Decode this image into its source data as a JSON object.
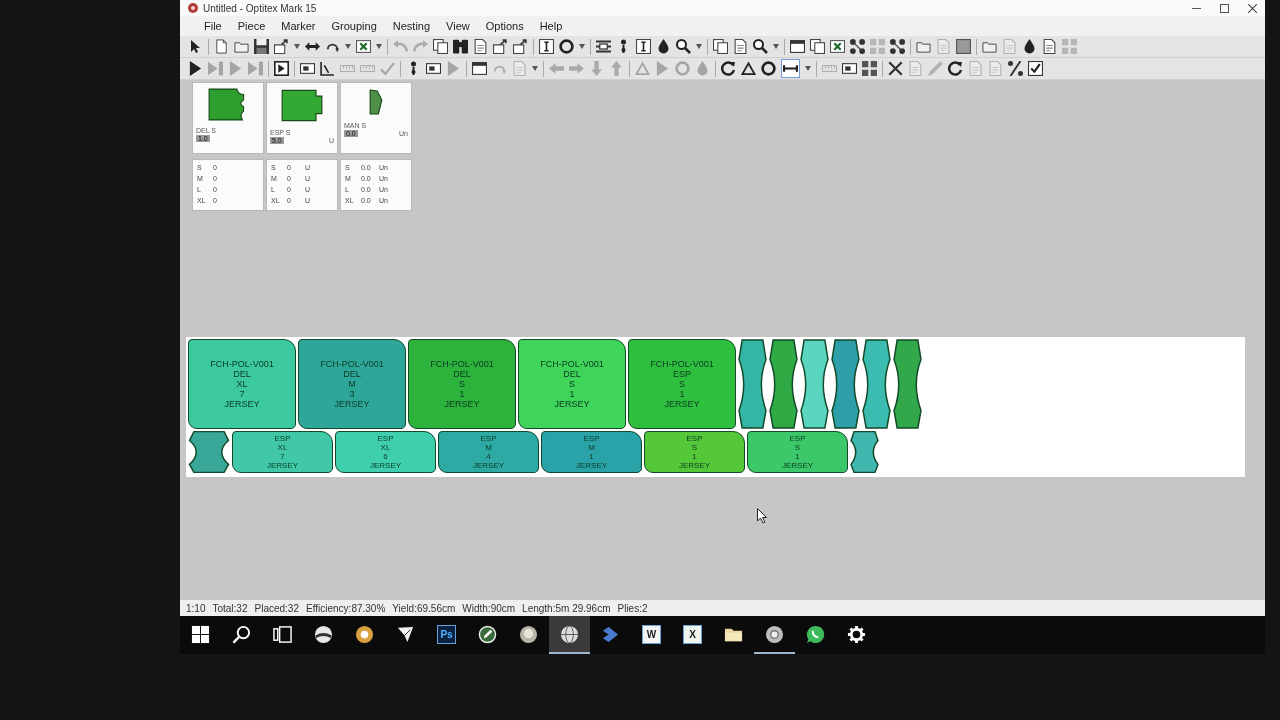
{
  "window": {
    "title": "Untitled - Optitex Mark 15"
  },
  "menu": [
    "File",
    "Piece",
    "Marker",
    "Grouping",
    "Nesting",
    "View",
    "Options",
    "Help"
  ],
  "toolbars": [
    [
      [
        {
          "kind": "pointer",
          "disabled": false,
          "pressed": false
        }
      ],
      [
        {
          "kind": "new",
          "disabled": false,
          "pressed": false
        },
        {
          "kind": "folder",
          "disabled": false,
          "pressed": false
        },
        {
          "kind": "save",
          "disabled": false,
          "pressed": false
        },
        {
          "kind": "export",
          "disabled": false,
          "pressed": false
        },
        {
          "kind": "caret",
          "disabled": false,
          "pressed": false
        },
        {
          "kind": "flip",
          "disabled": false,
          "pressed": false
        },
        {
          "kind": "rotate",
          "disabled": false,
          "pressed": false
        },
        {
          "kind": "caret",
          "disabled": false,
          "pressed": false
        },
        {
          "kind": "crossbox",
          "disabled": false,
          "pressed": false
        },
        {
          "kind": "caret",
          "disabled": false,
          "pressed": false
        }
      ],
      [
        {
          "kind": "undo",
          "disabled": true,
          "pressed": false
        },
        {
          "kind": "redo",
          "disabled": true,
          "pressed": false
        },
        {
          "kind": "copy",
          "disabled": false,
          "pressed": false
        },
        {
          "kind": "binoculars",
          "disabled": false,
          "pressed": false
        },
        {
          "kind": "page",
          "disabled": false,
          "pressed": false
        },
        {
          "kind": "export",
          "disabled": false,
          "pressed": false
        },
        {
          "kind": "export",
          "disabled": false,
          "pressed": false
        }
      ],
      [
        {
          "kind": "ibeam",
          "disabled": false,
          "pressed": false
        },
        {
          "kind": "ring",
          "disabled": false,
          "pressed": false
        },
        {
          "kind": "caret",
          "disabled": false,
          "pressed": false
        }
      ],
      [
        {
          "kind": "align",
          "disabled": false,
          "pressed": false
        },
        {
          "kind": "pin",
          "disabled": false,
          "pressed": false
        },
        {
          "kind": "ibeam",
          "disabled": false,
          "pressed": false
        },
        {
          "kind": "drop",
          "disabled": false,
          "pressed": false
        },
        {
          "kind": "search",
          "disabled": false,
          "pressed": false
        },
        {
          "kind": "caret",
          "disabled": false,
          "pressed": false
        }
      ],
      [
        {
          "kind": "copy",
          "disabled": false,
          "pressed": false
        },
        {
          "kind": "page",
          "disabled": false,
          "pressed": false
        },
        {
          "kind": "search",
          "disabled": false,
          "pressed": false
        },
        {
          "kind": "caret",
          "disabled": false,
          "pressed": false
        }
      ],
      [
        {
          "kind": "window",
          "disabled": false,
          "pressed": false
        },
        {
          "kind": "copy",
          "disabled": false,
          "pressed": false
        },
        {
          "kind": "crossbox",
          "disabled": false,
          "pressed": false
        },
        {
          "kind": "nodes",
          "disabled": false,
          "pressed": false
        },
        {
          "kind": "grid",
          "disabled": true,
          "pressed": false
        },
        {
          "kind": "nodes",
          "disabled": false,
          "pressed": false
        }
      ],
      [
        {
          "kind": "folder",
          "disabled": false,
          "pressed": false
        },
        {
          "kind": "page",
          "disabled": true,
          "pressed": false
        },
        {
          "kind": "square",
          "disabled": false,
          "pressed": false
        }
      ],
      [
        {
          "kind": "folder",
          "disabled": false,
          "pressed": false
        },
        {
          "kind": "page",
          "disabled": true,
          "pressed": false
        },
        {
          "kind": "drop",
          "disabled": false,
          "pressed": false
        },
        {
          "kind": "page",
          "disabled": false,
          "pressed": false
        },
        {
          "kind": "grid",
          "disabled": true,
          "pressed": false
        }
      ]
    ],
    [
      [
        {
          "kind": "play",
          "disabled": false,
          "pressed": false
        },
        {
          "kind": "skip",
          "disabled": true,
          "pressed": false
        },
        {
          "kind": "play",
          "disabled": true,
          "pressed": false
        },
        {
          "kind": "skip",
          "disabled": true,
          "pressed": false
        }
      ],
      [
        {
          "kind": "frame",
          "disabled": false,
          "pressed": false
        }
      ],
      [
        {
          "kind": "box",
          "disabled": false,
          "pressed": false
        },
        {
          "kind": "measure",
          "disabled": false,
          "pressed": false
        },
        {
          "kind": "ruler",
          "disabled": true,
          "pressed": false
        },
        {
          "kind": "ruler",
          "disabled": true,
          "pressed": false
        },
        {
          "kind": "check",
          "disabled": true,
          "pressed": false
        }
      ],
      [
        {
          "kind": "pin",
          "disabled": false,
          "pressed": false
        },
        {
          "kind": "box",
          "disabled": false,
          "pressed": false
        },
        {
          "kind": "play",
          "disabled": true,
          "pressed": false
        }
      ],
      [
        {
          "kind": "window",
          "disabled": false,
          "pressed": false
        },
        {
          "kind": "rotate",
          "disabled": true,
          "pressed": false
        },
        {
          "kind": "page",
          "disabled": true,
          "pressed": false
        },
        {
          "kind": "caret",
          "disabled": false,
          "pressed": false
        }
      ],
      [
        {
          "kind": "arrow-left",
          "disabled": true,
          "pressed": false
        },
        {
          "kind": "arrow-right",
          "disabled": true,
          "pressed": false
        },
        {
          "kind": "arrow-down",
          "disabled": true,
          "pressed": false
        },
        {
          "kind": "arrow-up",
          "disabled": true,
          "pressed": false
        }
      ],
      [
        {
          "kind": "triangle",
          "disabled": true,
          "pressed": false
        },
        {
          "kind": "play",
          "disabled": true,
          "pressed": false
        },
        {
          "kind": "ring",
          "disabled": true,
          "pressed": false
        },
        {
          "kind": "drop",
          "disabled": true,
          "pressed": false
        }
      ],
      [
        {
          "kind": "refresh",
          "disabled": false,
          "pressed": false
        },
        {
          "kind": "triangle",
          "disabled": false,
          "pressed": false
        },
        {
          "kind": "ring",
          "disabled": false,
          "pressed": false
        },
        {
          "kind": "bar",
          "disabled": false,
          "pressed": true
        },
        {
          "kind": "caret",
          "disabled": false,
          "pressed": false
        }
      ],
      [
        {
          "kind": "ruler",
          "disabled": true,
          "pressed": false
        },
        {
          "kind": "box",
          "disabled": false,
          "pressed": false
        },
        {
          "kind": "grid",
          "disabled": false,
          "pressed": false
        }
      ],
      [
        {
          "kind": "cross",
          "disabled": false,
          "pressed": false
        },
        {
          "kind": "page",
          "disabled": true,
          "pressed": false
        },
        {
          "kind": "pen",
          "disabled": true,
          "pressed": false
        },
        {
          "kind": "refresh",
          "disabled": false,
          "pressed": false
        },
        {
          "kind": "page",
          "disabled": true,
          "pressed": false
        },
        {
          "kind": "page",
          "disabled": true,
          "pressed": false
        },
        {
          "kind": "slash",
          "disabled": false,
          "pressed": false
        },
        {
          "kind": "checkbox",
          "disabled": false,
          "pressed": false
        }
      ]
    ]
  ],
  "gallery": [
    {
      "name": "DEL S",
      "quantity": "1.0",
      "kind": "front",
      "color": "#2e9e2e",
      "sizes": [
        {
          "size": "S",
          "count": "0"
        },
        {
          "size": "M",
          "count": "0"
        },
        {
          "size": "L",
          "count": "0"
        },
        {
          "size": "XL",
          "count": "0"
        }
      ]
    },
    {
      "name": "ESP S",
      "quantity": "5.0",
      "unit": "U",
      "kind": "back",
      "color": "#33a833",
      "sizes": [
        {
          "size": "S",
          "count": "0",
          "unit": "U"
        },
        {
          "size": "M",
          "count": "0",
          "unit": "U"
        },
        {
          "size": "L",
          "count": "0",
          "unit": "U"
        },
        {
          "size": "XL",
          "count": "0",
          "unit": "U"
        }
      ]
    },
    {
      "name": "MAN S",
      "quantity": "0.0",
      "unit": "Un",
      "kind": "sleeve",
      "color": "#4f8f48",
      "sizes": [
        {
          "size": "S",
          "count": "0.0",
          "unit": "Un"
        },
        {
          "size": "M",
          "count": "0.0",
          "unit": "Un"
        },
        {
          "size": "L",
          "count": "0.0",
          "unit": "Un"
        },
        {
          "size": "XL",
          "count": "0.0",
          "unit": "Un"
        }
      ]
    }
  ],
  "marker": {
    "upper_pieces": [
      {
        "kind": "panel",
        "color": "#3cc9a0",
        "lines": [
          "FCH-POL-V001",
          "DEL",
          "XL",
          "7",
          "JERSEY"
        ]
      },
      {
        "kind": "panel",
        "color": "#2ea79a",
        "lines": [
          "FCH-POL-V001",
          "DEL",
          "M",
          "3",
          "JERSEY"
        ]
      },
      {
        "kind": "panel",
        "color": "#2db33c",
        "lines": [
          "FCH-POL-V001",
          "DEL",
          "S",
          "1",
          "JERSEY"
        ]
      },
      {
        "kind": "panel",
        "color": "#3fd45a",
        "lines": [
          "FCH-POL-V001",
          "DEL",
          "S",
          "1",
          "JERSEY"
        ]
      },
      {
        "kind": "panel",
        "color": "#2fbf3e",
        "lines": [
          "FCH-POL-V001",
          "ESP",
          "S",
          "1",
          "JERSEY"
        ]
      },
      {
        "kind": "small",
        "color": "#35b5a5"
      },
      {
        "kind": "small",
        "color": "#2faa45"
      },
      {
        "kind": "small",
        "color": "#5ad6c0"
      },
      {
        "kind": "small",
        "color": "#2e9ea8"
      },
      {
        "kind": "small",
        "color": "#3cbcb0"
      },
      {
        "kind": "small",
        "color": "#32a84a"
      }
    ],
    "lower_pieces": [
      {
        "kind": "small",
        "color": "#3aa898"
      },
      {
        "kind": "panel",
        "color": "#40c8a8",
        "lines": [
          "ESP",
          "XL",
          "7",
          "JERSEY"
        ]
      },
      {
        "kind": "panel",
        "color": "#3fcfae",
        "lines": [
          "ESP",
          "XL",
          "6",
          "JERSEY"
        ]
      },
      {
        "kind": "panel",
        "color": "#2eaaa5",
        "lines": [
          "ESP",
          "M",
          "4",
          "JERSEY"
        ]
      },
      {
        "kind": "panel",
        "color": "#2aa3a8",
        "lines": [
          "ESP",
          "M",
          "1",
          "JERSEY"
        ]
      },
      {
        "kind": "panel",
        "color": "#55c83a",
        "lines": [
          "ESP",
          "S",
          "1",
          "JERSEY"
        ]
      },
      {
        "kind": "panel",
        "color": "#3cc86a",
        "lines": [
          "ESP",
          "S",
          "1",
          "JERSEY"
        ]
      },
      {
        "kind": "small",
        "color": "#40b8b0"
      }
    ]
  },
  "status_bar": [
    "1:10",
    "Total:32",
    "Placed:32",
    "Efficiency:87.30%",
    "Yield:69.56cm",
    "Width:90cm",
    "Length:5m 29.96cm",
    "Plies:2"
  ],
  "taskbar": [
    {
      "kind": "start",
      "selected": false,
      "running": false
    },
    {
      "kind": "search",
      "selected": false,
      "running": false
    },
    {
      "kind": "taskview",
      "selected": false,
      "running": false
    },
    {
      "kind": "sphere",
      "selected": false,
      "running": false
    },
    {
      "kind": "sun",
      "selected": false,
      "running": false
    },
    {
      "kind": "pen",
      "selected": false,
      "running": false
    },
    {
      "kind": "letter",
      "label": "Ps",
      "color": "#0b2340",
      "selected": false,
      "running": false
    },
    {
      "kind": "pencil",
      "selected": false,
      "running": false
    },
    {
      "kind": "disc",
      "selected": false,
      "running": false
    },
    {
      "kind": "globe",
      "selected": true,
      "running": true
    },
    {
      "kind": "ribbon",
      "selected": false,
      "running": false
    },
    {
      "kind": "letter",
      "label": "W",
      "color": "#f4f4f4",
      "selected": false,
      "running": false
    },
    {
      "kind": "letter",
      "label": "X",
      "color": "#eef4ee",
      "selected": false,
      "running": false
    },
    {
      "kind": "folder",
      "selected": false,
      "running": false
    },
    {
      "kind": "ring",
      "selected": false,
      "running": true
    },
    {
      "kind": "chat",
      "selected": false,
      "running": false
    },
    {
      "kind": "gear",
      "selected": false,
      "running": false
    }
  ]
}
